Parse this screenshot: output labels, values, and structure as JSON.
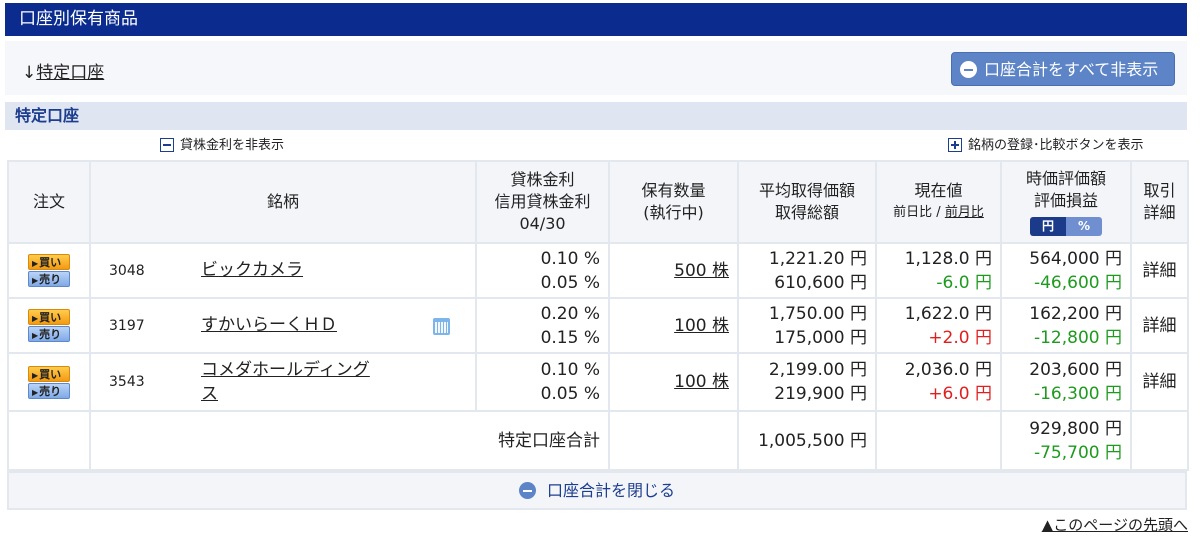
{
  "header": {
    "title": "口座別保有商品"
  },
  "anchor": {
    "arrow": "↓",
    "label": "特定口座"
  },
  "hide_all_button": {
    "label": "口座合計をすべて非表示"
  },
  "section": {
    "title": "特定口座"
  },
  "toggle_lending": {
    "label": "貸株金利を非表示"
  },
  "toggle_register": {
    "label": "銘柄の登録･比較ボタンを表示"
  },
  "columns": {
    "order": "注文",
    "name": "銘柄",
    "lending_1": "貸株金利",
    "lending_2": "信用貸株金利",
    "lending_3": "04/30",
    "qty_1": "保有数量",
    "qty_2": "(執行中)",
    "avg_1": "平均取得価額",
    "avg_2": "取得総額",
    "price_1": "現在値",
    "price_day": "前日比",
    "price_sep": " / ",
    "price_month": "前月比",
    "val_1": "時価評価額",
    "val_2": "評価損益",
    "unit_yen": "円",
    "unit_pct": "%",
    "detail_1": "取引",
    "detail_2": "詳細"
  },
  "order_buttons": {
    "buy": "買い",
    "sell": "売り",
    "arrow": "▶"
  },
  "rows": [
    {
      "code": "3048",
      "name": "ビックカメラ",
      "rate1": "0.10 %",
      "rate2": "0.05 %",
      "qty": "500 株",
      "avg": "1,221.20 円",
      "total": "610,600 円",
      "price": "1,128.0 円",
      "change": "-6.0 円",
      "value": "564,000 円",
      "pl": "-46,600 円",
      "detail": "詳細"
    },
    {
      "code": "3197",
      "name": "すかいらーくＨＤ",
      "rate1": "0.20 %",
      "rate2": "0.15 %",
      "qty": "100 株",
      "avg": "1,750.00 円",
      "total": "175,000 円",
      "price": "1,622.0 円",
      "change": "+2.0 円",
      "value": "162,200 円",
      "pl": "-12,800 円",
      "detail": "詳細"
    },
    {
      "code": "3543",
      "name_l1": "コメダホールディング",
      "name_l2": "ス",
      "rate1": "0.10 %",
      "rate2": "0.05 %",
      "qty": "100 株",
      "avg": "2,199.00 円",
      "total": "219,900 円",
      "price": "2,036.0 円",
      "change": "+6.0 円",
      "value": "203,600 円",
      "pl": "-16,300 円",
      "detail": "詳細"
    }
  ],
  "totals": {
    "label": "特定口座合計",
    "acquisition": "1,005,500 円",
    "value": "929,800 円",
    "pl": "-75,700 円"
  },
  "close_button": {
    "label": "口座合計を閉じる"
  },
  "page_top_link": {
    "label": "▲このページの先頭へ"
  },
  "colors": {
    "header_bg": "#0b2b8f",
    "button_bg": "#5d84c6",
    "loss": "#1e9a1e",
    "gain": "#e02020"
  },
  "icons": {
    "calendar": "calendar-icon",
    "minus": "minus-circle-icon"
  }
}
